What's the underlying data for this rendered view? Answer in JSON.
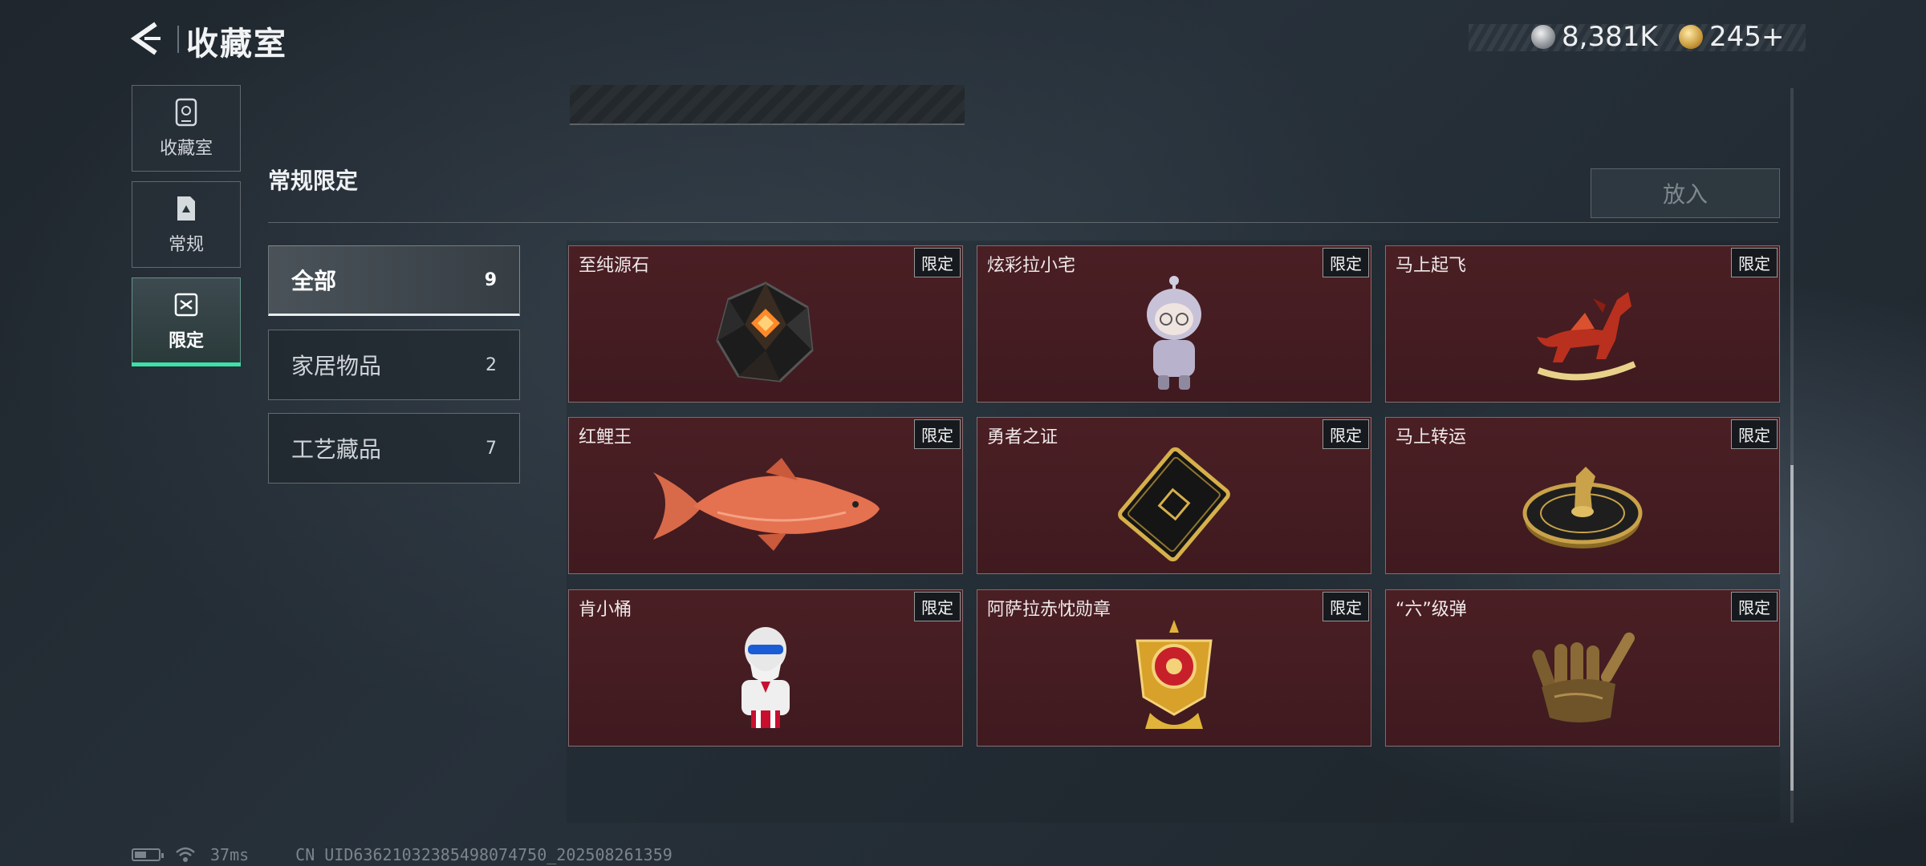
{
  "header": {
    "title": "收藏室",
    "currency_silver": "8,381K",
    "currency_gold": "245+"
  },
  "sidebar": {
    "items": [
      {
        "label": "收藏室",
        "icon": "collection-room-icon"
      },
      {
        "label": "常规",
        "icon": "regular-doc-icon"
      },
      {
        "label": "限定",
        "icon": "limited-icon",
        "active": true
      }
    ]
  },
  "section": {
    "title": "常规限定",
    "put_in_label": "放入"
  },
  "filters": [
    {
      "label": "全部",
      "count": "9",
      "active": true
    },
    {
      "label": "家居物品",
      "count": "2"
    },
    {
      "label": "工艺藏品",
      "count": "7"
    }
  ],
  "items": [
    {
      "name": "至纯源石",
      "tag": "限定",
      "icon": "source-stone-icon"
    },
    {
      "name": "炫彩拉小宅",
      "tag": "限定",
      "icon": "figurine-icon"
    },
    {
      "name": "马上起飞",
      "tag": "限定",
      "icon": "rocking-horse-icon"
    },
    {
      "name": "红鲤王",
      "tag": "限定",
      "icon": "red-carp-icon"
    },
    {
      "name": "勇者之证",
      "tag": "限定",
      "icon": "brave-card-icon"
    },
    {
      "name": "马上转运",
      "tag": "限定",
      "icon": "fortune-wheel-icon"
    },
    {
      "name": "肯小桶",
      "tag": "限定",
      "icon": "colonel-bust-icon"
    },
    {
      "name": "阿萨拉赤忱勋章",
      "tag": "限定",
      "icon": "medal-icon"
    },
    {
      "name": "“六”级弹",
      "tag": "限定",
      "icon": "bullet-hand-icon"
    }
  ],
  "footer": {
    "ping": "37ms",
    "uid": "CN UID63621032385498074750_202508261359"
  },
  "colors": {
    "accent_green": "#3ee0a8",
    "card_red": "#4a1f24"
  }
}
